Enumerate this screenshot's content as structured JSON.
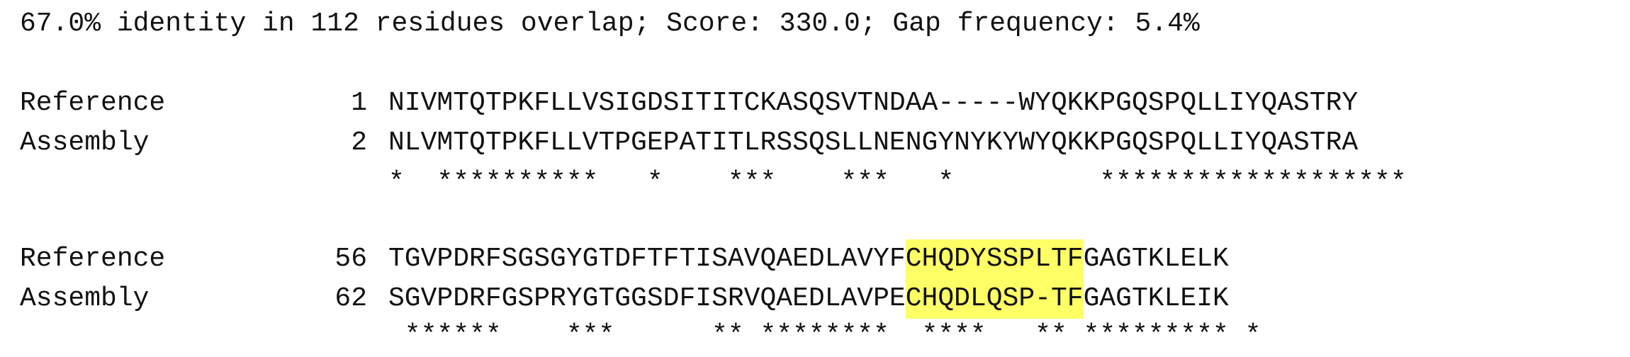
{
  "summary": "67.0% identity in 112 residues overlap; Score: 330.0; Gap frequency: 5.4%",
  "blocks": [
    {
      "reference": {
        "label": "Reference",
        "start": "1",
        "sequence": "NIVMTQTPKFLLVSIGDSITITCKASQSVTNDAA-----WYQKKPGQSPQLLIYQASTRY"
      },
      "assembly": {
        "label": "Assembly",
        "start": "2",
        "sequence": "NLVMTQTPKFLLVTPGEPATITLRSSQSLLNENGYNYKYWYQKKPGQSPQLLIYQASTRA"
      },
      "markers": "*  **********   *    ***    ***   *         ******************* "
    },
    {
      "reference": {
        "label": "Reference",
        "start": "56",
        "seq_before": "TGVPDRFSGSGYGTDFTFTISAVQAEDLAVYF",
        "seq_highlight": "CHQDYSSPLTF",
        "seq_after": "GAGTKLELK"
      },
      "assembly": {
        "label": "Assembly",
        "start": "62",
        "seq_before": "SGVPDRFGSPRYGTGGSDFISRVQAEDLAVPE",
        "seq_highlight": "CHQDLQSP-TF",
        "seq_after": "GAGTKLEIK"
      },
      "markers": " ******    ***      ** ********  ****   ** ********* *"
    }
  ],
  "highlight_color": "#ffff66"
}
